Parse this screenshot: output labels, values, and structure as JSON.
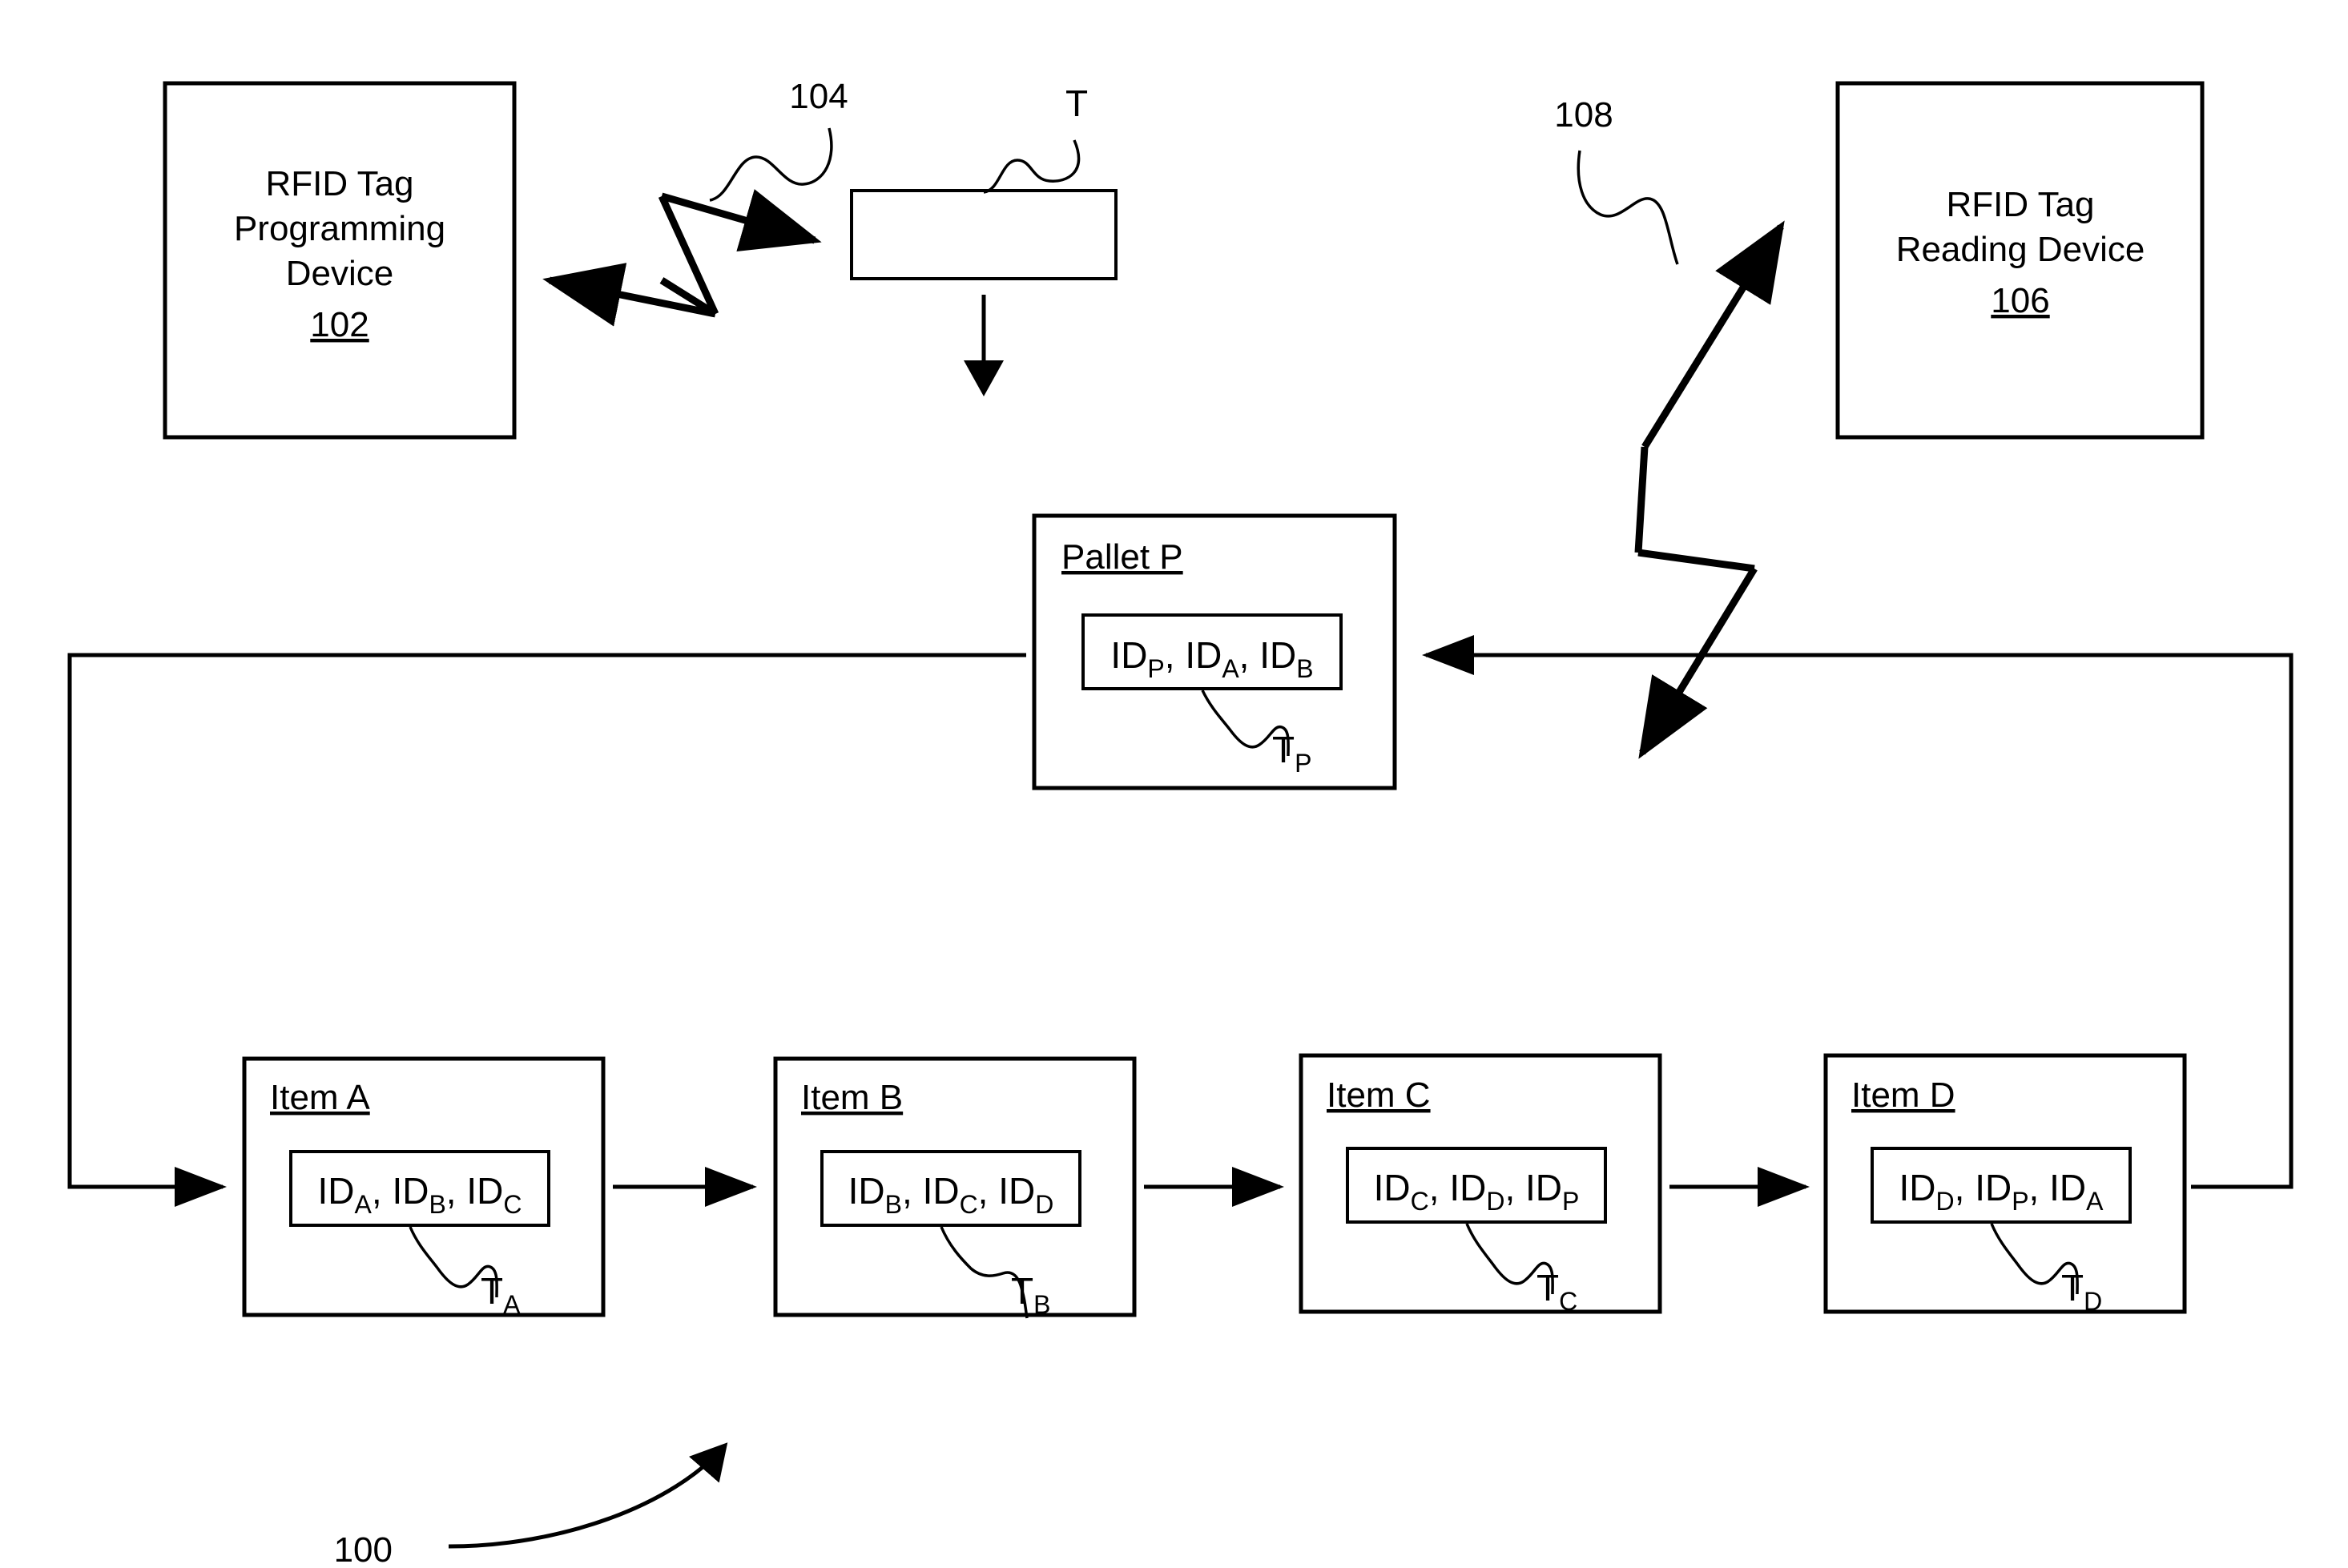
{
  "figure": {
    "ref_label": "100",
    "background_color": "#ffffff",
    "line_color": "#000000"
  },
  "programming_device": {
    "line1": "RFID Tag",
    "line2": "Programming",
    "line3": "Device",
    "ref": "102"
  },
  "reading_device": {
    "line1": "RFID Tag",
    "line2": "Reading Device",
    "ref": "106"
  },
  "signals": {
    "programming_signal_ref": "104",
    "reading_signal_ref": "108"
  },
  "blank_tag": {
    "label": "T"
  },
  "pallet": {
    "title": "Pallet P",
    "ids": [
      {
        "prefix": "ID",
        "sub": "P",
        "sep": ", "
      },
      {
        "prefix": "ID",
        "sub": "A",
        "sep": ", "
      },
      {
        "prefix": "ID",
        "sub": "B",
        "sep": ""
      }
    ],
    "tag_prefix": "T",
    "tag_sub": "P"
  },
  "items": [
    {
      "title": "Item A",
      "ids": [
        {
          "prefix": "ID",
          "sub": "A",
          "sep": ", "
        },
        {
          "prefix": "ID",
          "sub": "B",
          "sep": ", "
        },
        {
          "prefix": "ID",
          "sub": "C",
          "sep": ""
        }
      ],
      "tag_prefix": "T",
      "tag_sub": "A"
    },
    {
      "title": "Item B",
      "ids": [
        {
          "prefix": "ID",
          "sub": "B",
          "sep": ", "
        },
        {
          "prefix": "ID",
          "sub": "C",
          "sep": ", "
        },
        {
          "prefix": "ID",
          "sub": "D",
          "sep": ""
        }
      ],
      "tag_prefix": "T",
      "tag_sub": "B"
    },
    {
      "title": "Item C",
      "ids": [
        {
          "prefix": "ID",
          "sub": "C",
          "sep": ", "
        },
        {
          "prefix": "ID",
          "sub": "D",
          "sep": ", "
        },
        {
          "prefix": "ID",
          "sub": "P",
          "sep": ""
        }
      ],
      "tag_prefix": "T",
      "tag_sub": "C"
    },
    {
      "title": "Item D",
      "ids": [
        {
          "prefix": "ID",
          "sub": "D",
          "sep": ", "
        },
        {
          "prefix": "ID",
          "sub": "P",
          "sep": ", "
        },
        {
          "prefix": "ID",
          "sub": "A",
          "sep": ""
        }
      ],
      "tag_prefix": "T",
      "tag_sub": "D"
    }
  ]
}
